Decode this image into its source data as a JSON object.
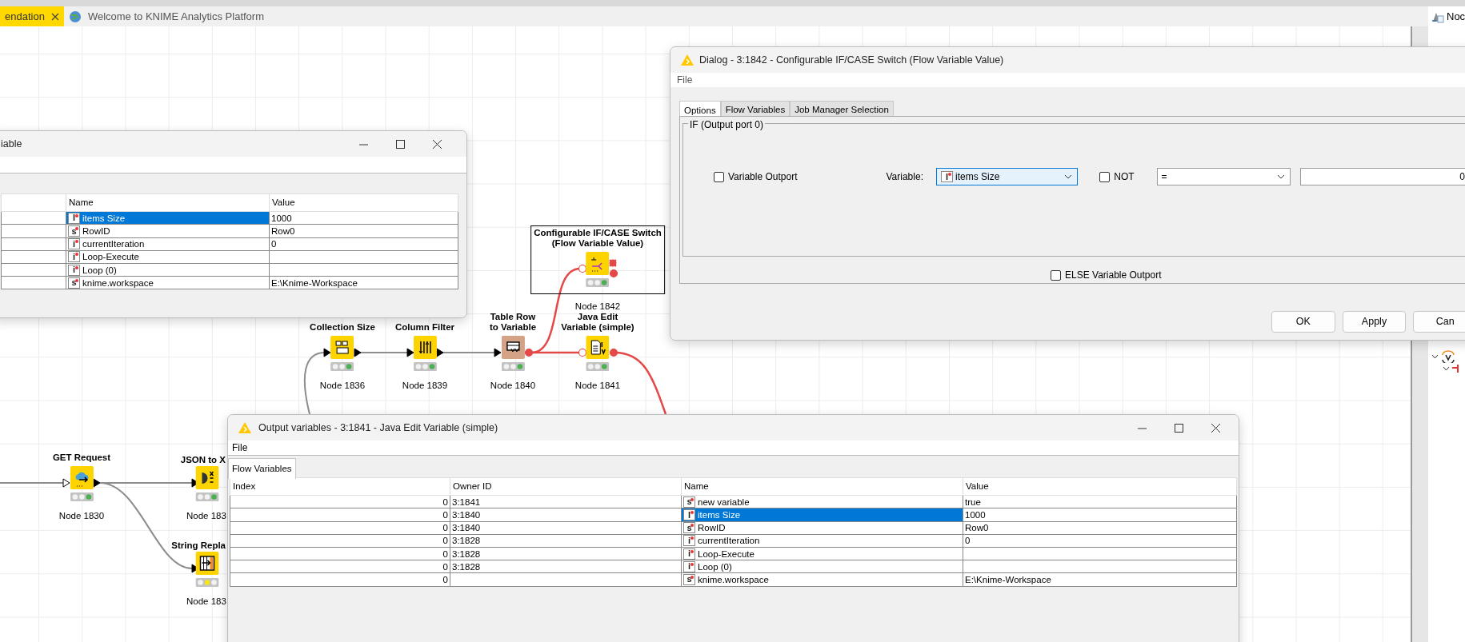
{
  "editor_tabs": [
    {
      "label": "endation",
      "selected": true,
      "closable": true
    },
    {
      "label": "Welcome to KNIME Analytics Platform",
      "selected": false,
      "closable": false
    }
  ],
  "side_panel": {
    "tab_label": "Noc"
  },
  "workflow": {
    "nodes": [
      {
        "kind": "if-switch",
        "label": "Configurable IF/CASE Switch\n(Flow Variable Value)",
        "id_label": "Node 1842",
        "executed": true,
        "color": "#fdd400",
        "selected": true
      },
      {
        "kind": "collection-size",
        "label": "Collection Size",
        "id_label": "Node 1836",
        "executed": true,
        "color": "#fdd400",
        "selected": false
      },
      {
        "kind": "column-filter",
        "label": "Column Filter",
        "id_label": "Node 1839",
        "executed": true,
        "color": "#fdd400",
        "selected": false
      },
      {
        "kind": "table-row-to-variable",
        "label": "Table Row\nto Variable",
        "id_label": "Node 1840",
        "executed": true,
        "color": "#d4a386",
        "selected": false
      },
      {
        "kind": "java-edit-variable",
        "label": "Java Edit\nVariable (simple)",
        "id_label": "Node 1841",
        "executed": true,
        "color": "#fdd400",
        "selected": false
      },
      {
        "kind": "get-request",
        "label": "GET Request",
        "id_label": "Node 1830",
        "executed": true,
        "color": "#fdd400",
        "selected": false
      },
      {
        "kind": "json-to-xml",
        "label": "JSON to X",
        "id_label": "Node 183",
        "executed": true,
        "color": "#fdd400",
        "selected": false
      },
      {
        "kind": "string-replace",
        "label": "String Repla",
        "id_label": "Node 183",
        "executed": false,
        "color": "#fdd400",
        "selected": false
      }
    ]
  },
  "variable_window": {
    "title": "iable",
    "columns": [
      "Name",
      "Value"
    ],
    "rows": [
      {
        "type": "I",
        "name": "items Size",
        "value": "1000",
        "selected": true
      },
      {
        "type": "s",
        "name": "RowID",
        "value": "Row0",
        "selected": false
      },
      {
        "type": "i",
        "name": "currentIteration",
        "value": "0",
        "selected": false
      },
      {
        "type": "i",
        "name": "Loop-Execute",
        "value": "",
        "selected": false
      },
      {
        "type": "i",
        "name": "Loop (0)",
        "value": "",
        "selected": false
      },
      {
        "type": "s",
        "name": "knime.workspace",
        "value": "E:\\Knime-Workspace",
        "selected": false
      }
    ]
  },
  "dialog": {
    "title": "Dialog - 3:1842 - Configurable IF/CASE Switch (Flow Variable Value)",
    "menu": [
      "File"
    ],
    "tabs": [
      {
        "label": "Options",
        "selected": true
      },
      {
        "label": "Flow Variables",
        "selected": false
      },
      {
        "label": "Job Manager Selection",
        "selected": false
      }
    ],
    "group_title": "IF (Output port 0)",
    "variable_outport": {
      "label": "Variable Outport",
      "checked": false
    },
    "variable_label": "Variable:",
    "variable_select": {
      "type": "I",
      "value": "items Size"
    },
    "not_checkbox": {
      "label": "NOT",
      "checked": false
    },
    "operator_select": {
      "value": "="
    },
    "compare_value": {
      "value": "0"
    },
    "else_outport": {
      "label": "ELSE Variable Outport",
      "checked": false
    },
    "buttons": [
      "OK",
      "Apply",
      "Can"
    ]
  },
  "output_window": {
    "title": "Output variables - 3:1841 - Java Edit Variable (simple)",
    "menu": [
      "File"
    ],
    "tabs": [
      {
        "label": "Flow Variables",
        "selected": true
      }
    ],
    "columns": [
      "Index",
      "Owner ID",
      "Name",
      "Value"
    ],
    "rows": [
      {
        "index": "0",
        "owner": "3:1841",
        "type": "s",
        "name": "new variable",
        "value": "true",
        "selected": false
      },
      {
        "index": "0",
        "owner": "3:1840",
        "type": "I",
        "name": "items Size",
        "value": "1000",
        "selected": true
      },
      {
        "index": "0",
        "owner": "3:1840",
        "type": "s",
        "name": "RowID",
        "value": "Row0",
        "selected": false
      },
      {
        "index": "0",
        "owner": "3:1828",
        "type": "i",
        "name": "currentIteration",
        "value": "0",
        "selected": false
      },
      {
        "index": "0",
        "owner": "3:1828",
        "type": "i",
        "name": "Loop-Execute",
        "value": "",
        "selected": false
      },
      {
        "index": "0",
        "owner": "3:1828",
        "type": "i",
        "name": "Loop (0)",
        "value": "",
        "selected": false
      },
      {
        "index": "0",
        "owner": "",
        "type": "s",
        "name": "knime.workspace",
        "value": "E:\\Knime-Workspace",
        "selected": false
      }
    ]
  }
}
